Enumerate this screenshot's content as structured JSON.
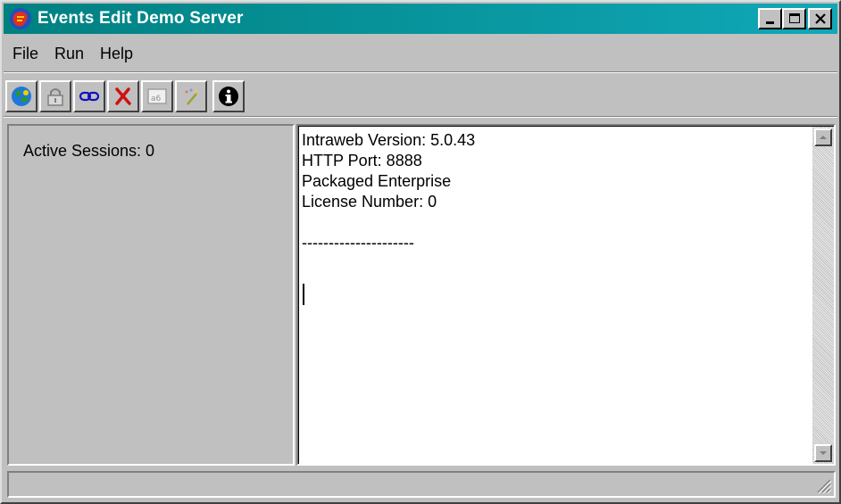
{
  "window": {
    "title": "Events Edit Demo Server"
  },
  "menu": {
    "items": [
      "File",
      "Run",
      "Help"
    ]
  },
  "toolbar": {
    "buttons": [
      "browser-icon",
      "lock-icon",
      "link-icon",
      "delete-icon",
      "counter-icon",
      "wand-icon",
      "info-icon"
    ]
  },
  "left_panel": {
    "active_sessions": "Active Sessions: 0"
  },
  "log": {
    "lines": [
      "Intraweb Version: 5.0.43",
      "HTTP Port: 8888",
      "Packaged Enterprise",
      "License Number: 0",
      "",
      "---------------------"
    ]
  },
  "status": {
    "text": ""
  }
}
